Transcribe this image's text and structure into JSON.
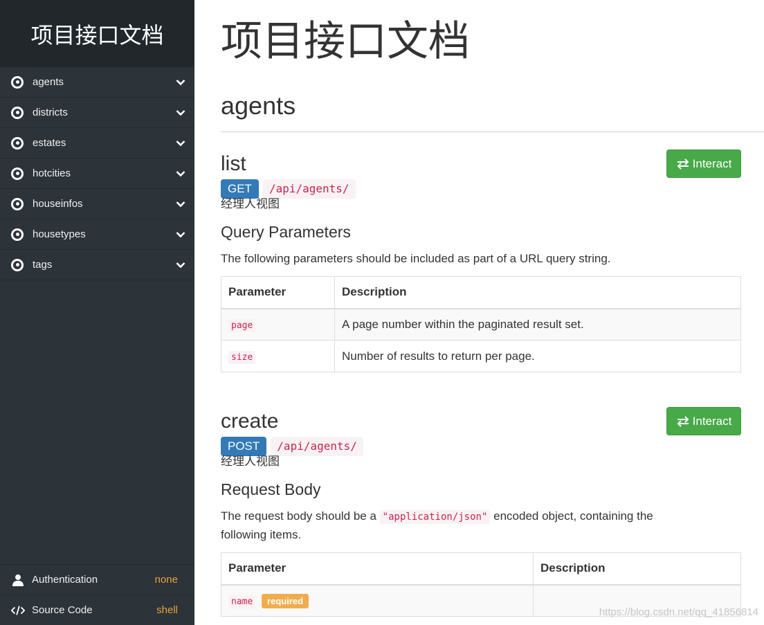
{
  "sidebar": {
    "brand": "项目接口文档",
    "items": [
      {
        "label": "agents"
      },
      {
        "label": "districts"
      },
      {
        "label": "estates"
      },
      {
        "label": "hotcities"
      },
      {
        "label": "houseinfos"
      },
      {
        "label": "housetypes"
      },
      {
        "label": "tags"
      }
    ],
    "bottom": {
      "auth_label": "Authentication",
      "auth_value": "none",
      "source_label": "Source Code",
      "source_value": "shell"
    }
  },
  "main": {
    "title": "项目接口文档",
    "section": "agents",
    "endpoints": [
      {
        "name": "list",
        "interact": "Interact",
        "method": "GET",
        "path": "/api/agents/",
        "desc": "经理人视图",
        "sub_title": "Query Parameters",
        "para": "The following parameters should be included as part of a URL query string.",
        "table": {
          "headers": [
            "Parameter",
            "Description"
          ],
          "rows": [
            {
              "param": "page",
              "desc": "A page number within the paginated result set."
            },
            {
              "param": "size",
              "desc": "Number of results to return per page."
            }
          ]
        }
      },
      {
        "name": "create",
        "interact": "Interact",
        "method": "POST",
        "path": "/api/agents/",
        "desc": "经理人视图",
        "sub_title": "Request Body",
        "para_before": "The request body should be a",
        "para_code": "\"application/json\"",
        "para_after": "encoded object, containing the following items.",
        "table": {
          "headers": [
            "Parameter",
            "Description"
          ],
          "rows": [
            {
              "param": "name",
              "badge": "required",
              "desc": ""
            }
          ]
        }
      }
    ]
  },
  "watermark": "https://blog.csdn.net/qq_41856814"
}
